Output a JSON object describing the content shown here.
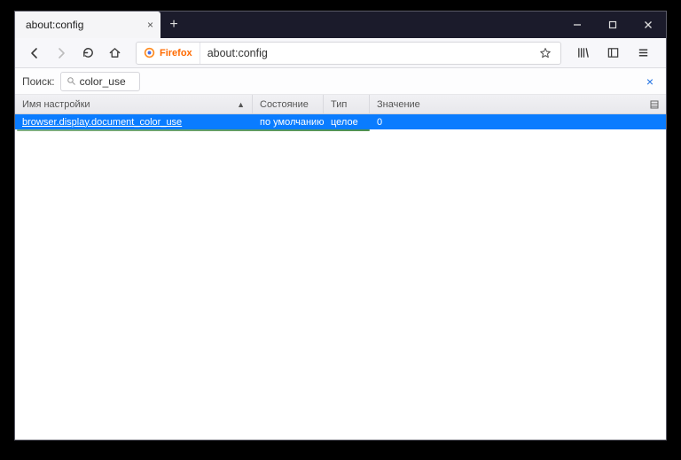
{
  "tab": {
    "title": "about:config"
  },
  "urlbar": {
    "identity": "Firefox",
    "url": "about:config"
  },
  "search": {
    "label": "Поиск:",
    "value": "color_use"
  },
  "columns": {
    "name": "Имя настройки",
    "state": "Состояние",
    "type": "Тип",
    "value": "Значение"
  },
  "rows": [
    {
      "name": "browser.display.document_color_use",
      "state": "по умолчанию",
      "type": "целое",
      "value": "0"
    }
  ]
}
